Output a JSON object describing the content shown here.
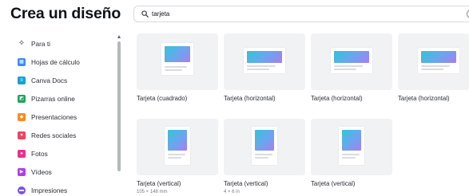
{
  "page": {
    "title": "Crea un diseño"
  },
  "search": {
    "value": "tarjeta",
    "placeholder": ""
  },
  "sidebar": {
    "items": [
      {
        "label": "Para ti",
        "icon": "sparkle-icon",
        "color": "#2b2f36"
      },
      {
        "label": "Hojas de cálculo",
        "icon": "spreadsheet-icon",
        "color": "#3d8bfd"
      },
      {
        "label": "Canva Docs",
        "icon": "docs-icon",
        "color": "#13a3d9"
      },
      {
        "label": "Pizarras online",
        "icon": "whiteboard-icon",
        "color": "#1fa35a"
      },
      {
        "label": "Presentaciones",
        "icon": "presentation-icon",
        "color": "#ff8a1e"
      },
      {
        "label": "Redes sociales",
        "icon": "heart-icon",
        "color": "#f0435f"
      },
      {
        "label": "Fotos",
        "icon": "photo-icon",
        "color": "#ec2f8c"
      },
      {
        "label": "Vídeos",
        "icon": "video-icon",
        "color": "#b23cf0"
      },
      {
        "label": "Impresiones",
        "icon": "print-icon",
        "color": "#7c4ff0"
      }
    ]
  },
  "results": [
    {
      "title": "Tarjeta (cuadrado)",
      "subtitle": ""
    },
    {
      "title": "Tarjeta (horizontal)",
      "subtitle": ""
    },
    {
      "title": "Tarjeta (horizontal)",
      "subtitle": ""
    },
    {
      "title": "Tarjeta (horizontal)",
      "subtitle": ""
    },
    {
      "title": "Tarjeta (vertical)",
      "subtitle": "105 × 148 mm"
    },
    {
      "title": "Tarjeta (vertical)",
      "subtitle": "4 × 6 in"
    },
    {
      "title": "Tarjeta (vertical)",
      "subtitle": ""
    }
  ],
  "colors": {
    "accent_gradient": [
      "#2fc6d8",
      "#6aa6ee",
      "#a77ff0"
    ],
    "tile_bg": "#f1f2f4"
  }
}
